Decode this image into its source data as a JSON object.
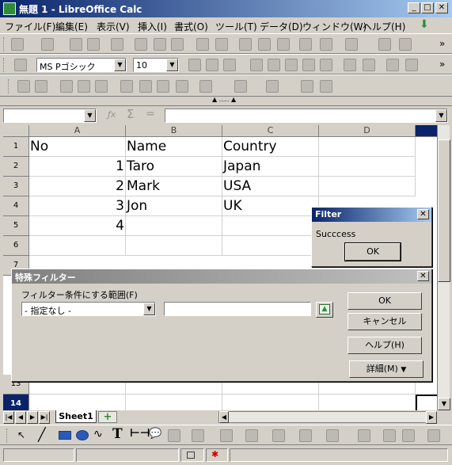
{
  "window": {
    "title": "無題 1 - LibreOffice Calc"
  },
  "menu": [
    "ファイル(F)",
    "編集(E)",
    "表示(V)",
    "挿入(I)",
    "書式(O)",
    "ツール(T)",
    "データ(D)",
    "ウィンドウ(W)",
    "ヘルプ(H)"
  ],
  "format_bar": {
    "font_name": "MS Pゴシック",
    "font_size": "10"
  },
  "columns": [
    "A",
    "B",
    "C",
    "D"
  ],
  "rows": [
    "1",
    "2",
    "3",
    "4",
    "5",
    "6",
    "7",
    "13",
    "14"
  ],
  "cells": {
    "r1": {
      "a": "No",
      "b": "Name",
      "c": "Country"
    },
    "r2": {
      "a": "1",
      "b": "Taro",
      "c": "Japan"
    },
    "r3": {
      "a": "2",
      "b": "Mark",
      "c": "USA"
    },
    "r4": {
      "a": "3",
      "b": "Jon",
      "c": "UK"
    },
    "r5": {
      "a": "4"
    }
  },
  "sheet_tab": "Sheet1",
  "filter_dialog": {
    "title": "Filter",
    "message": "Succcess",
    "ok_label": "OK"
  },
  "special_filter": {
    "title": "特殊フィルター",
    "range_label": "フィルター条件にする範囲(F)",
    "range_select": "- 指定なし -",
    "ok_label": "OK",
    "cancel_label": "キャンセル",
    "help_label": "ヘルプ(H)",
    "details_label": "詳細(M)"
  }
}
